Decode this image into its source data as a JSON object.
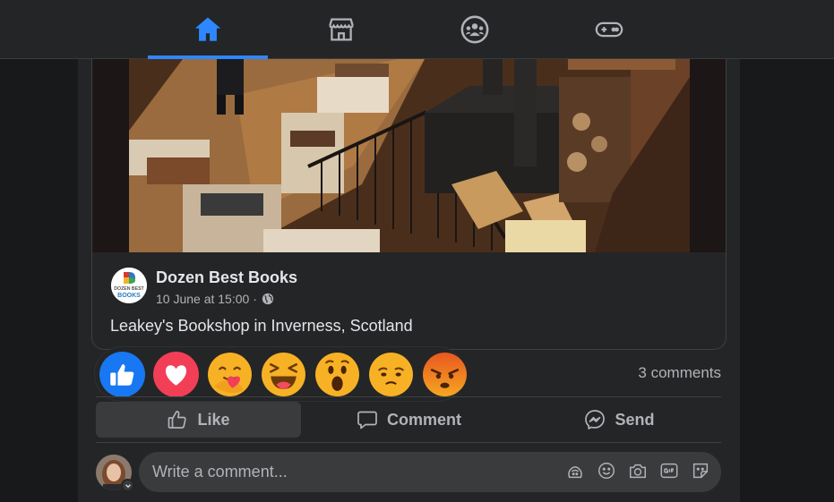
{
  "nav": {
    "tabs": [
      {
        "name": "home",
        "icon": "home-icon",
        "active": true
      },
      {
        "name": "marketplace",
        "icon": "storefront-icon",
        "active": false
      },
      {
        "name": "groups",
        "icon": "groups-icon",
        "active": false
      },
      {
        "name": "gaming",
        "icon": "gamepad-icon",
        "active": false
      }
    ],
    "active_color": "#2d88ff"
  },
  "post": {
    "page_name": "Dozen Best Books",
    "logo_text": [
      "DOZEN BEST",
      "BOOKS"
    ],
    "timestamp": "10 June at 15:00 ·",
    "text": "Leakey's Bookshop in Inverness, Scotland"
  },
  "reactions": [
    "like",
    "love",
    "care",
    "haha",
    "wow",
    "sad",
    "angry"
  ],
  "stats": {
    "comments": "3 comments"
  },
  "actions": {
    "like": "Like",
    "comment": "Comment",
    "send": "Send"
  },
  "comment_box": {
    "placeholder": "Write a comment...",
    "icons": [
      "avatar-sticker-icon",
      "emoji-icon",
      "camera-icon",
      "gif-icon",
      "sticker-icon"
    ]
  },
  "colors": {
    "background": "#18191a",
    "surface": "#242526",
    "input": "#3a3b3c",
    "text_primary": "#e4e6eb",
    "text_secondary": "#b0b3b8"
  }
}
